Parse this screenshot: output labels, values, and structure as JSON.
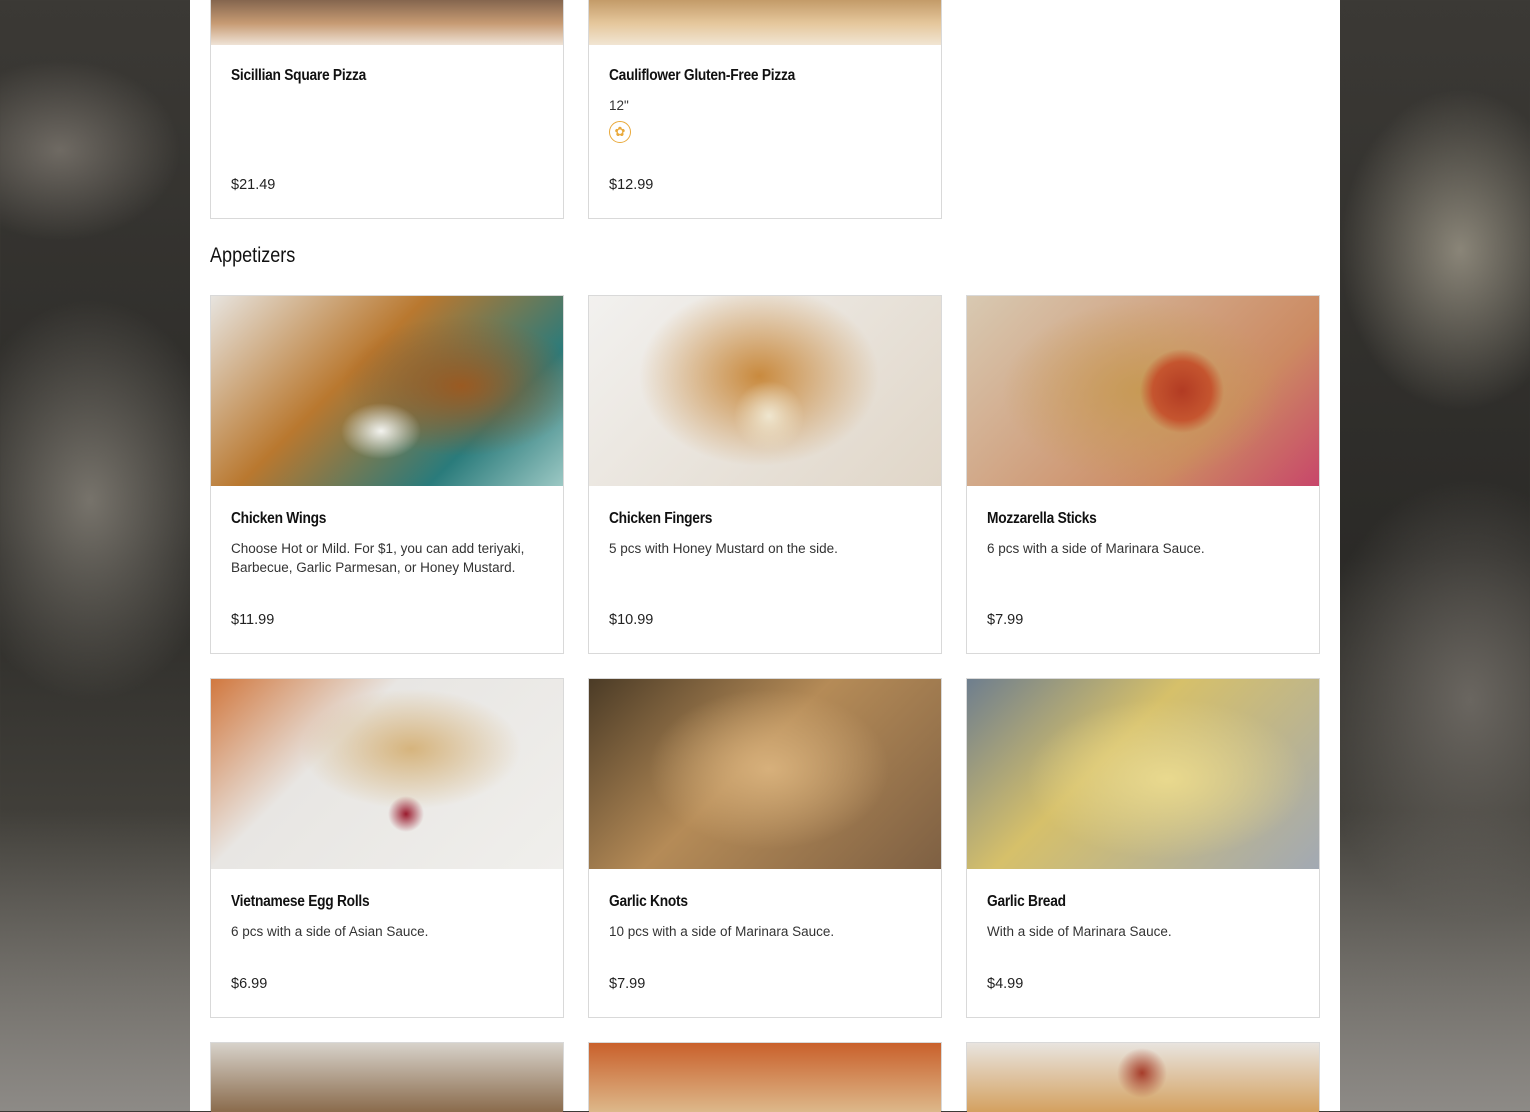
{
  "top_items": [
    {
      "name": "Sicillian Square Pizza",
      "desc": "",
      "price": "$21.49"
    },
    {
      "name": "Cauliflower Gluten-Free Pizza",
      "desc": "12\"",
      "price": "$12.99",
      "badge": "gluten-free-icon"
    }
  ],
  "section": {
    "title": "Appetizers"
  },
  "appetizers": [
    {
      "name": "Chicken Wings",
      "desc": "Choose Hot or Mild. For $1, you can add teriyaki, Barbecue, Garlic Parmesan, or Honey Mustard.",
      "price": "$11.99"
    },
    {
      "name": "Chicken Fingers",
      "desc": "5 pcs with Honey Mustard on the side.",
      "price": "$10.99"
    },
    {
      "name": "Mozzarella Sticks",
      "desc": "6 pcs with a side of Marinara Sauce.",
      "price": "$7.99"
    },
    {
      "name": "Vietnamese Egg Rolls",
      "desc": "6 pcs with a side of Asian Sauce.",
      "price": "$6.99"
    },
    {
      "name": "Garlic Knots",
      "desc": "10 pcs with a side of Marinara Sauce.",
      "price": "$7.99"
    },
    {
      "name": "Garlic Bread",
      "desc": "With a side of Marinara Sauce.",
      "price": "$4.99"
    }
  ],
  "colors": {
    "badge": "#e9a93a",
    "border": "#d9d9d9"
  }
}
